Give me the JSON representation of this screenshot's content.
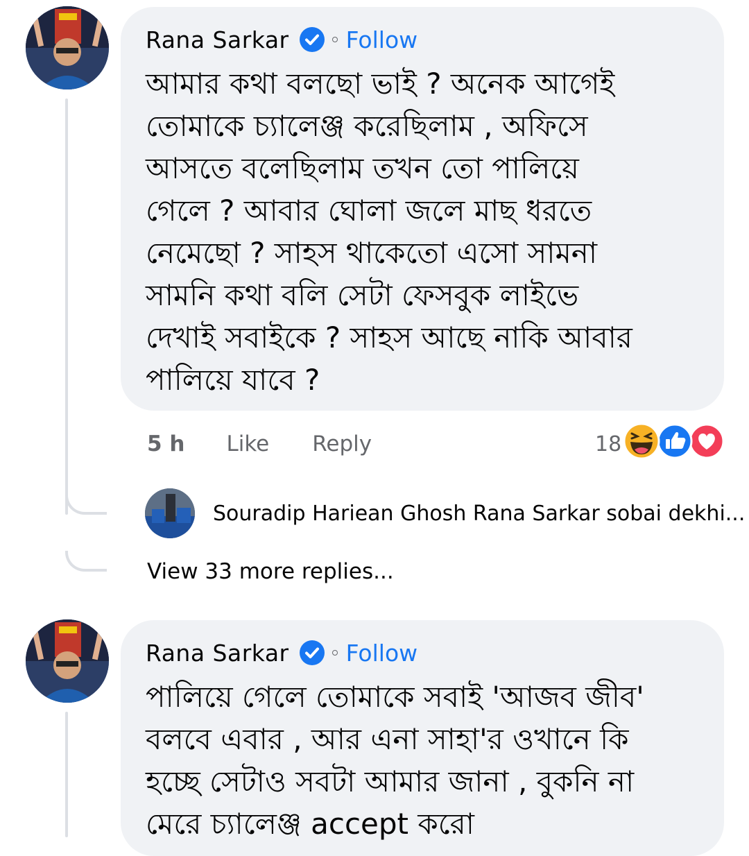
{
  "comments": [
    {
      "author": "Rana Sarkar",
      "follow_label": "Follow",
      "text": "আমার কথা বলছো ভাই ? অনেক আগেই\nতোমাকে চ্যালেঞ্জ করেছিলাম , অফিসে\nআসতে বলেছিলাম তখন তো পালিয়ে\nগেলে ? আবার ঘোলা জলে মাছ ধরতে\nনেমেছো ? সাহস থাকেতো এসো সামনা\nসামনি কথা বলি সেটা ফেসবুক লাইভে\nদেখাই সবাইকে ? সাহস আছে নাকি আবার\nপালিয়ে যাবে ?",
      "time": "5 h",
      "like_label": "Like",
      "reply_label": "Reply",
      "reaction_count": "18",
      "reactions": [
        "haha-icon",
        "like-icon",
        "love-icon"
      ],
      "reply_preview": {
        "author": "Souradip Hariean Ghosh",
        "text": "Rana Sarkar sobai dekhi..."
      },
      "more_replies": "View 33 more replies..."
    },
    {
      "author": "Rana Sarkar",
      "follow_label": "Follow",
      "text": "পালিয়ে গেলে তোমাকে সবাই 'আজব জীব'\nবলবে এবার , আর এনা সাহা'র ওখানে কি\nহচ্ছে সেটাও সবটা আমার জানা , বুকনি না\nমেরে চ্যালেঞ্জ accept করো"
    }
  ],
  "colors": {
    "bubble": "#f0f2f5",
    "follow": "#1877f2",
    "verified": "#1877f2",
    "meta": "#65676b"
  }
}
